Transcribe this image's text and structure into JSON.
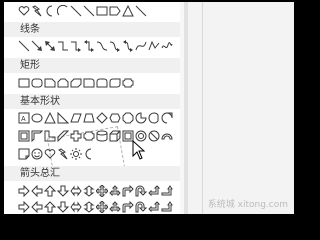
{
  "sections": [
    {
      "label": ""
    },
    {
      "label": "线条"
    },
    {
      "label": "矩形"
    },
    {
      "label": "基本形状"
    },
    {
      "label": "箭头总汇"
    }
  ],
  "shape_groups": {
    "recent": [
      "heart-icon",
      "lightning-icon",
      "moon-icon",
      "arc-icon",
      "line-icon",
      "line-icon",
      "rectangle-icon",
      "pentagon-icon",
      "triangle-icon",
      "line-icon"
    ],
    "lines": [
      "line-icon",
      "arrow-line-icon",
      "double-arrow-line-icon",
      "elbow-connector-icon",
      "elbow-arrow-icon",
      "elbow-double-arrow-icon",
      "curved-connector-icon",
      "curved-arrow-icon",
      "curved-double-arrow-icon",
      "curve-icon",
      "freeform-icon",
      "scribble-icon"
    ],
    "rectangles": [
      "rectangle-icon",
      "rounded-rectangle-icon",
      "snip-corner-icon",
      "snip-same-side-icon",
      "snip-diagonal-icon",
      "round-corner-icon",
      "round-same-side-icon",
      "round-diagonal-icon",
      "plaque-icon"
    ],
    "basic": [
      "text-box-icon",
      "oval-icon",
      "triangle-icon",
      "right-triangle-icon",
      "parallelogram-icon",
      "trapezoid-icon",
      "diamond-icon",
      "hexagon-icon",
      "octagon-icon",
      "pie-icon",
      "chord-icon",
      "teardrop-icon",
      "frame-icon",
      "half-frame-icon",
      "l-shape-icon",
      "diagonal-stripe-icon",
      "cross-icon",
      "plaque-icon",
      "can-icon",
      "cube-icon",
      "bevel-icon",
      "donut-icon",
      "no-symbol-icon",
      "block-arc-icon",
      "folded-corner-icon",
      "smiley-icon",
      "heart-icon",
      "lightning-icon",
      "sun-icon",
      "moon-icon"
    ],
    "arrows": [
      "right-arrow-icon",
      "left-arrow-icon",
      "up-arrow-icon",
      "down-arrow-icon",
      "left-right-arrow-icon",
      "up-down-arrow-icon",
      "quad-arrow-icon",
      "left-right-up-arrow-icon",
      "bent-arrow-icon",
      "u-turn-arrow-icon",
      "left-up-arrow-icon",
      "bent-up-arrow-icon"
    ]
  },
  "watermark": "系统城 xitong.com"
}
